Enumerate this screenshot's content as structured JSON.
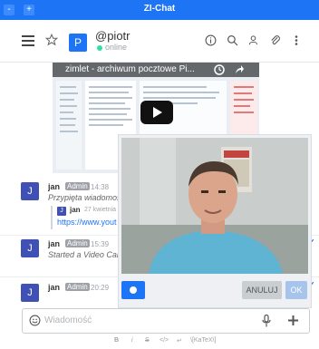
{
  "window": {
    "title": "ZI-Chat",
    "minimize": "-",
    "maximize": "+"
  },
  "header": {
    "avatar_letter": "P",
    "username": "@piotr",
    "status": "online"
  },
  "video_preview": {
    "title": "zimlet - archiwum pocztowe Pi..."
  },
  "messages": [
    {
      "avatar": "J",
      "user": "jan",
      "badge": "Admin",
      "time": "14:38",
      "text": "Przypięta wiadomoś",
      "quote": {
        "avatar": "J",
        "user": "jan",
        "date": "27 kwietnia",
        "link": "https://www.yout"
      }
    },
    {
      "avatar": "J",
      "user": "jan",
      "badge": "Admin",
      "time": "15:39",
      "text": "Started a Video Call"
    },
    {
      "avatar": "J",
      "user": "jan",
      "badge": "Admin",
      "time": "20:29"
    }
  ],
  "video_call": {
    "cancel_label": "ANULUJ",
    "ok_label": "OK"
  },
  "composer": {
    "placeholder": "Wiadomość"
  },
  "format_toolbar": [
    "B",
    "i",
    "S",
    "</>",
    "↵",
    "\\[KaTeX\\]"
  ],
  "colors": {
    "titlebar": "#1d74f5",
    "accent": "#1d74f5",
    "avatar": "#3f51b5",
    "online": "#2de0a5"
  }
}
